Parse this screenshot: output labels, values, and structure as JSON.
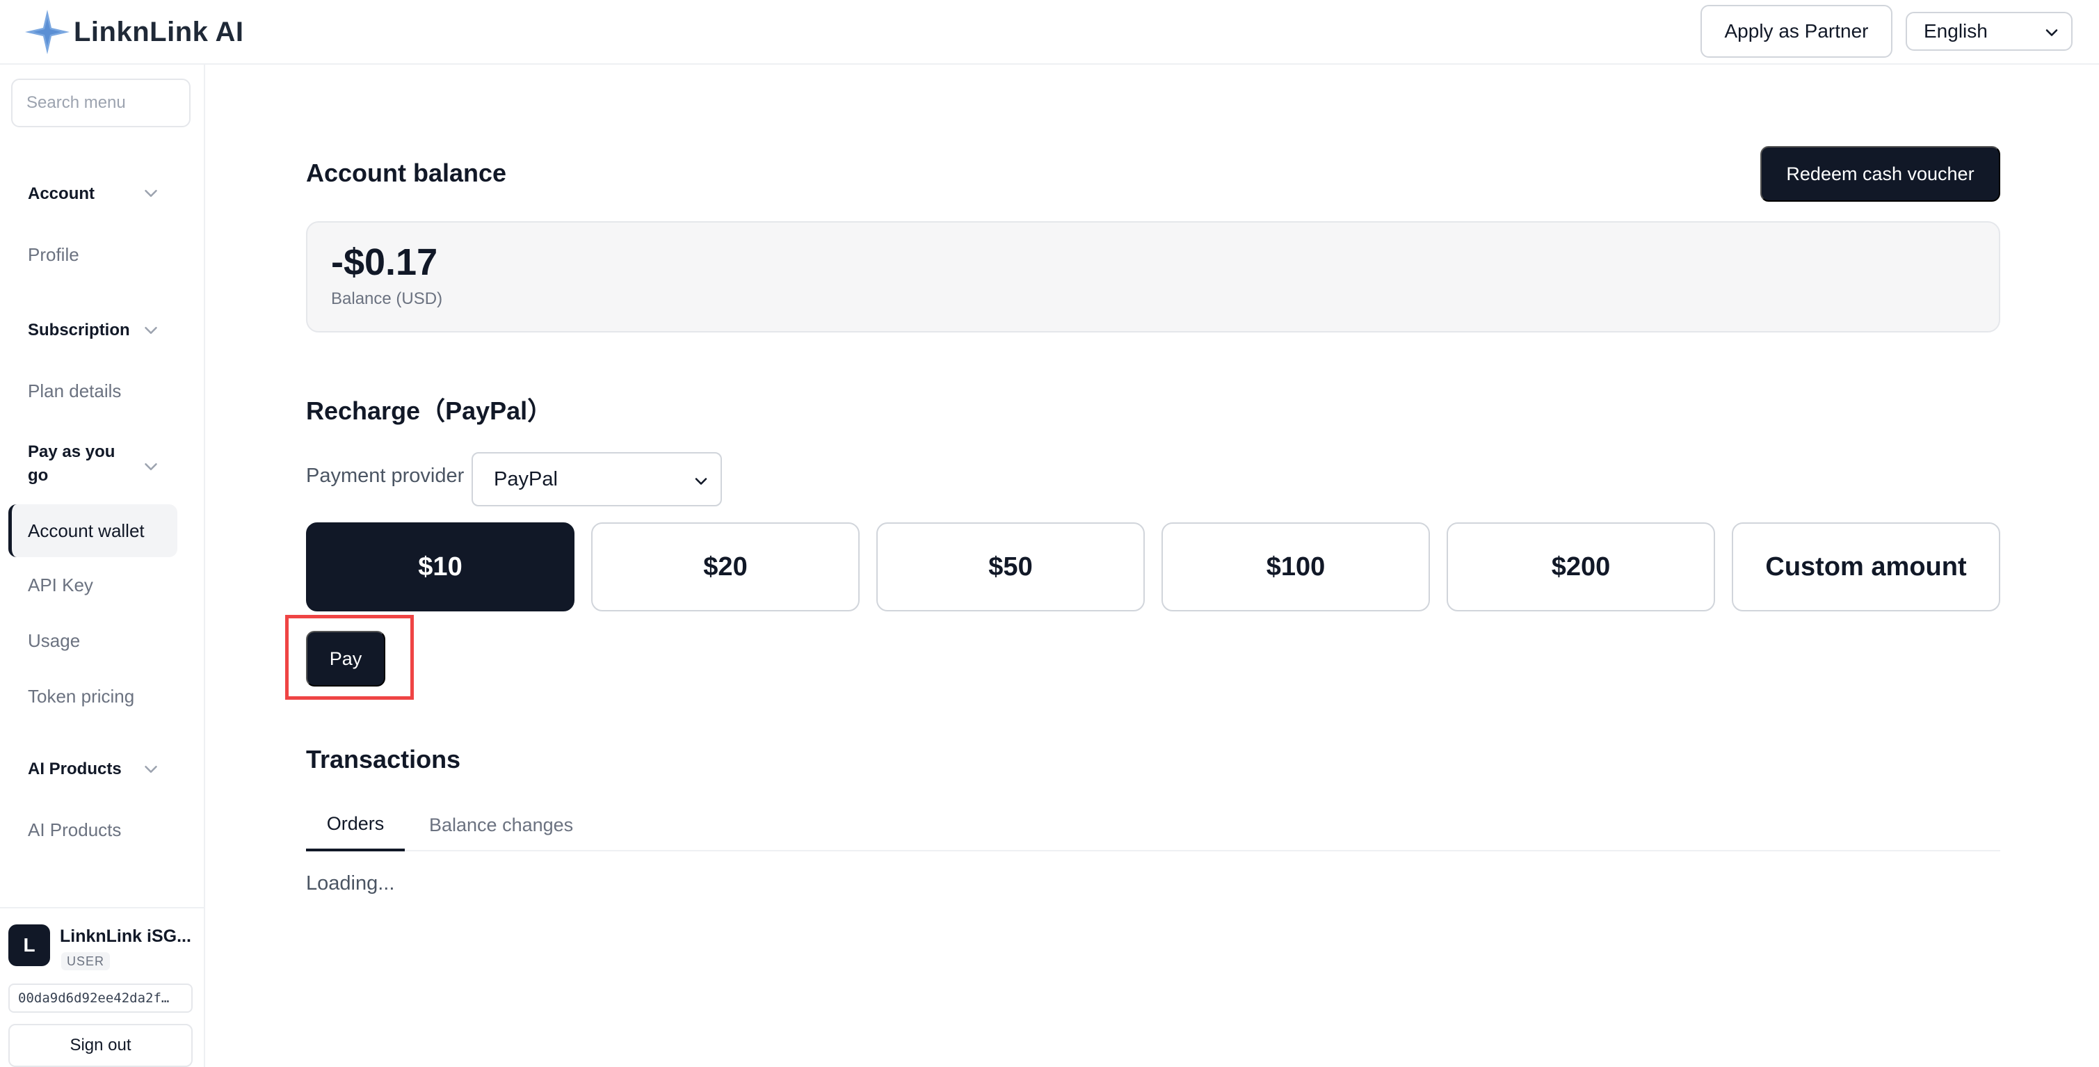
{
  "header": {
    "brand": "LinknLink AI",
    "partner_button": "Apply as Partner",
    "language": "English"
  },
  "sidebar": {
    "search_placeholder": "Search menu",
    "groups": [
      {
        "title": "Account",
        "items": [
          "Profile"
        ]
      },
      {
        "title": "Subscription",
        "items": [
          "Plan details"
        ]
      },
      {
        "title": "Pay as you go",
        "items": [
          "Account wallet",
          "API Key",
          "Usage",
          "Token pricing"
        ]
      },
      {
        "title": "AI Products",
        "items": [
          "AI Products"
        ]
      }
    ],
    "active_item": "Account wallet",
    "user": {
      "initial": "L",
      "name": "LinknLink iSG...",
      "role": "USER",
      "id": "00da9d6d92ee42da2f…",
      "sign_out": "Sign out"
    }
  },
  "main": {
    "balance_title": "Account balance",
    "redeem_button": "Redeem cash voucher",
    "balance_value": "-$0.17",
    "balance_label": "Balance (USD)",
    "recharge_title": "Recharge（PayPal）",
    "provider_label": "Payment provider",
    "provider_value": "PayPal",
    "amounts": [
      "$10",
      "$20",
      "$50",
      "$100",
      "$200",
      "Custom amount"
    ],
    "selected_amount": "$10",
    "pay_button": "Pay",
    "transactions_title": "Transactions",
    "tabs": [
      "Orders",
      "Balance changes"
    ],
    "active_tab": "Orders",
    "loading_text": "Loading..."
  },
  "colors": {
    "primary": "#111827",
    "highlight": "#ef4444",
    "logo": "#7aa7e0"
  }
}
